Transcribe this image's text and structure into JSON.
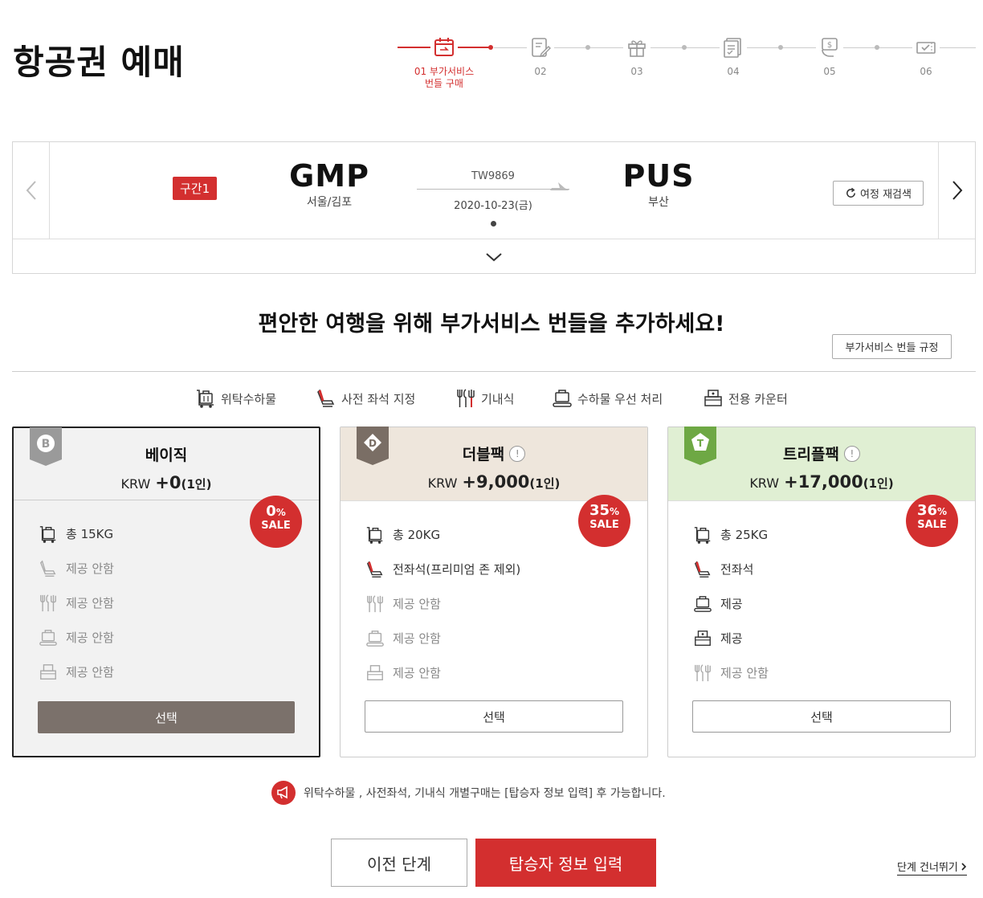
{
  "page": {
    "title": "항공권 예매"
  },
  "stepper": {
    "steps": [
      {
        "label": "01 부가서비스",
        "label2": "번들 구매",
        "icon": "calendar-flight-icon",
        "active": true
      },
      {
        "label": "02",
        "label2": "",
        "icon": "edit-form-icon",
        "active": false
      },
      {
        "label": "03",
        "label2": "",
        "icon": "gift-icon",
        "active": false
      },
      {
        "label": "04",
        "label2": "",
        "icon": "checklist-icon",
        "active": false
      },
      {
        "label": "05",
        "label2": "",
        "icon": "payment-icon",
        "active": false
      },
      {
        "label": "06",
        "label2": "",
        "icon": "ticket-check-icon",
        "active": false
      }
    ]
  },
  "segment": {
    "badge": "구간1",
    "origin": {
      "code": "GMP",
      "city": "서울/김포"
    },
    "destination": {
      "code": "PUS",
      "city": "부산"
    },
    "flight_no": "TW9869",
    "date": "2020-10-23(금)",
    "research_label": "여정 재검색"
  },
  "headline": "편안한 여행을 위해 부가서비스 번들을 추가하세요!",
  "rules_label": "부가서비스 번들 규정",
  "legend": [
    {
      "label": "위탁수하물",
      "icon": "baggage-cart-icon"
    },
    {
      "label": "사전 좌석 지정",
      "icon": "seat-icon"
    },
    {
      "label": "기내식",
      "icon": "meal-icon"
    },
    {
      "label": "수하물 우선 처리",
      "icon": "priority-baggage-icon"
    },
    {
      "label": "전용 카운터",
      "icon": "counter-icon"
    }
  ],
  "cards": {
    "basic": {
      "tag": "B",
      "name": "베이직",
      "currency": "KRW",
      "price": "+0",
      "per": "(1인)",
      "sale_pct": "0",
      "sale_word": "SALE",
      "features": [
        "총 15KG",
        "제공 안함",
        "제공 안함",
        "제공 안함",
        "제공 안함"
      ],
      "select_label": "선택"
    },
    "double": {
      "tag": "D",
      "name": "더블팩",
      "currency": "KRW",
      "price": "+9,000",
      "per": "(1인)",
      "sale_pct": "35",
      "sale_word": "SALE",
      "features": [
        "총 20KG",
        "전좌석(프리미엄 존 제외)",
        "제공 안함",
        "제공 안함",
        "제공 안함"
      ],
      "select_label": "선택"
    },
    "triple": {
      "tag": "T",
      "name": "트리플팩",
      "currency": "KRW",
      "price": "+17,000",
      "per": "(1인)",
      "sale_pct": "36",
      "sale_word": "SALE",
      "features": [
        "총 25KG",
        "전좌석",
        "제공",
        "제공",
        "제공 안함"
      ],
      "select_label": "선택"
    }
  },
  "notice": "위탁수하물 , 사전좌석, 기내식 개별구매는 [탑승자 정보 입력] 후 가능합니다.",
  "footer": {
    "prev_label": "이전 단계",
    "next_label": "탑승자 정보 입력",
    "skip_label": "단계 건너뛰기"
  },
  "colors": {
    "accent": "#d32f2f",
    "double_head": "#eee6dc",
    "triple_head": "#e0efd3",
    "selected_btn": "#7b716b"
  }
}
